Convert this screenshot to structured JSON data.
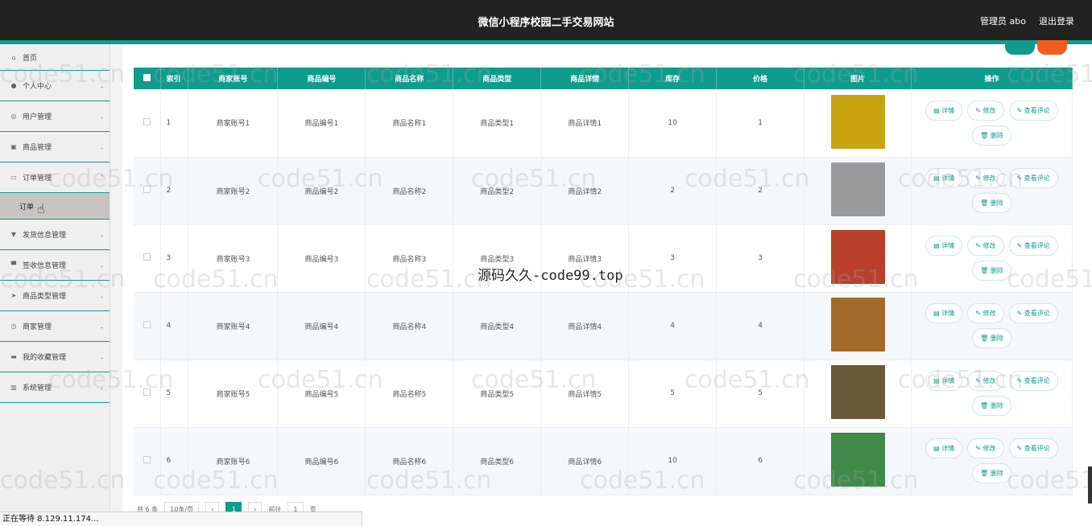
{
  "header": {
    "title": "微信小程序校园二手交易网站",
    "admin": "管理员 abo",
    "logout": "退出登录"
  },
  "sidebar": {
    "home": "首页",
    "items": [
      {
        "label": "个人中心",
        "icon": "user-icon"
      },
      {
        "label": "用户管理",
        "icon": "users-icon"
      },
      {
        "label": "商品管理",
        "icon": "box-icon"
      },
      {
        "label": "订单管理",
        "icon": "order-icon"
      },
      {
        "label": "发货信息管理",
        "icon": "shipping-icon"
      },
      {
        "label": "签收信息管理",
        "icon": "receipt-icon"
      },
      {
        "label": "商品类型管理",
        "icon": "send-icon"
      },
      {
        "label": "商家管理",
        "icon": "clock-icon"
      },
      {
        "label": "我的收藏管理",
        "icon": "favorite-icon"
      },
      {
        "label": "系统管理",
        "icon": "chart-icon"
      }
    ],
    "sub_order": "订单"
  },
  "table": {
    "headers": [
      "索引",
      "商家账号",
      "商品编号",
      "商品名称",
      "商品类型",
      "商品详情",
      "库存",
      "价格",
      "图片",
      "操作"
    ],
    "rows": [
      {
        "idx": "1",
        "merchant": "商家账号1",
        "code": "商品编号1",
        "name": "商品名称1",
        "type": "商品类型1",
        "detail": "商品详情1",
        "stock": "10",
        "price": "1",
        "img": "#c9a312"
      },
      {
        "idx": "2",
        "merchant": "商家账号2",
        "code": "商品编号2",
        "name": "商品名称2",
        "type": "商品类型2",
        "detail": "商品详情2",
        "stock": "2",
        "price": "2",
        "img": "#9a9a9a"
      },
      {
        "idx": "3",
        "merchant": "商家账号3",
        "code": "商品编号3",
        "name": "商品名称3",
        "type": "商品类型3",
        "detail": "商品详情3",
        "stock": "3",
        "price": "3",
        "img": "#b8402a"
      },
      {
        "idx": "4",
        "merchant": "商家账号4",
        "code": "商品编号4",
        "name": "商品名称4",
        "type": "商品类型4",
        "detail": "商品详情4",
        "stock": "4",
        "price": "4",
        "img": "#a36a2b"
      },
      {
        "idx": "5",
        "merchant": "商家账号5",
        "code": "商品编号5",
        "name": "商品名称5",
        "type": "商品类型5",
        "detail": "商品详情5",
        "stock": "5",
        "price": "5",
        "img": "#6b5a3a"
      },
      {
        "idx": "6",
        "merchant": "商家账号6",
        "code": "商品编号6",
        "name": "商品名称6",
        "type": "商品类型6",
        "detail": "商品详情6",
        "stock": "10",
        "price": "6",
        "img": "#3f8a48"
      }
    ],
    "actions": {
      "detail": "详情",
      "edit": "修改",
      "review": "查看评论",
      "delete": "删除"
    }
  },
  "pager": {
    "total": "共 6 条",
    "size": "10条/页",
    "page": "1",
    "goto": "前往",
    "goto_val": "1",
    "unit": "页"
  },
  "status": "正在等待 8.129.11.174...",
  "watermark": {
    "text": "code51.cn",
    "center": "源码久久-code99.top"
  }
}
